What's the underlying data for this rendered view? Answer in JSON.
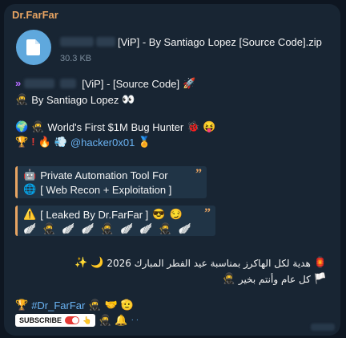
{
  "message": {
    "sender": "Dr.FarFar",
    "file": {
      "icon": "document-icon",
      "name": "[ViP] - By Santiago Lopez [Source Code].zip",
      "size": "30.3 KB"
    },
    "header_title": "[ViP] - [Source Code]",
    "author_line": "By Santiago Lopez",
    "hunter_line": "World's First $1M Bug Hunter",
    "handle": "@hacker0x01",
    "quote1": {
      "line1": "Private Automation Tool For",
      "line2": "[ Web Recon + Exploitation ]"
    },
    "quote2": {
      "line1": "[ Leaked By Dr.FarFar ]"
    },
    "arabic_line1": "هدية لكل الهاكرز بمناسبة عيد الفطر المبارك 2026",
    "arabic_line2": "كل عام وأنتم بخير",
    "hashtag": "#Dr_FarFar",
    "subscribe_label": "SUBSCRIBE",
    "colors": {
      "background": "#0e1621",
      "bubble": "#182533",
      "sender": "#e8a462",
      "link": "#6ab3f3",
      "file_icon": "#5fa8dd"
    }
  }
}
